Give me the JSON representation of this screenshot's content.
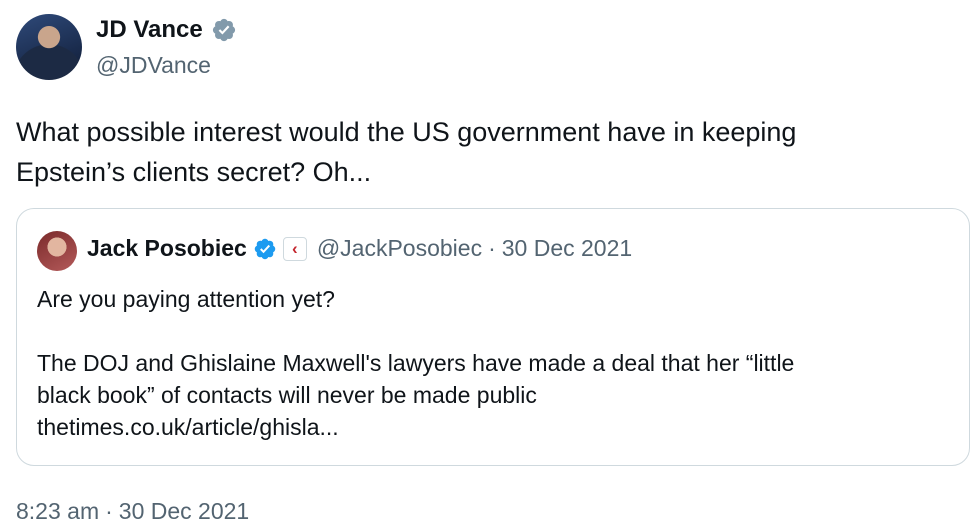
{
  "author": {
    "display_name": "JD Vance",
    "handle": "@JDVance",
    "verified_badge": "verified-gray-badge",
    "badge_color": "#829aab"
  },
  "tweet": {
    "text_line1": "What possible interest would the US government have in keeping",
    "text_line2": "Epstein’s clients secret? Oh..."
  },
  "quoted_tweet": {
    "display_name": "Jack Posobiec",
    "verified_badge": "verified-blue-badge",
    "badge_color": "#1d9bf0",
    "affiliation_icon": "affiliate-icon",
    "handle": "@JackPosobiec",
    "separator": "·",
    "date": "30 Dec 2021",
    "line1": "Are you paying attention yet?",
    "line2": "The DOJ and Ghislaine Maxwell's lawyers have made a deal that her “little",
    "line3": "black book” of contacts will never be made public",
    "link": "thetimes.co.uk/article/ghisla..."
  },
  "timestamp": {
    "time": "8:23 am",
    "separator": "·",
    "date": "30 Dec 2021"
  }
}
